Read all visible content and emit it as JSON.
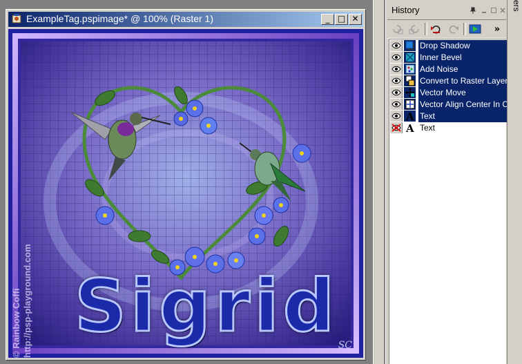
{
  "image_window": {
    "title": "ExampleTag.pspimage* @ 100% (Raster 1)",
    "minimize_symbol": "_",
    "maximize_symbol": "□",
    "close_symbol": "✕",
    "app_icon": "psp-image-icon"
  },
  "canvas": {
    "name_text": "Sigrid",
    "watermark_line1": "© Rainbow Coffi",
    "watermark_line2": "http://psp-playground.com",
    "signature": "SC"
  },
  "history": {
    "title": "History",
    "toolbar_icons": [
      "undo-selective-icon",
      "redo-selective-icon",
      "undo-icon",
      "redo-icon",
      "quickscript-icon",
      "more-icon"
    ],
    "more_label": "»",
    "items": [
      {
        "label": "Drop Shadow",
        "icon": "drop-shadow-icon",
        "visible": true,
        "selected": true
      },
      {
        "label": "Inner Bevel",
        "icon": "inner-bevel-icon",
        "visible": true,
        "selected": true
      },
      {
        "label": "Add Noise",
        "icon": "add-noise-icon",
        "visible": true,
        "selected": true
      },
      {
        "label": "Convert to Raster Layer",
        "icon": "convert-raster-icon",
        "visible": true,
        "selected": true
      },
      {
        "label": "Vector Move",
        "icon": "vector-move-icon",
        "visible": true,
        "selected": true
      },
      {
        "label": "Vector Align Center In Canvas",
        "icon": "vector-align-icon",
        "visible": true,
        "selected": true
      },
      {
        "label": "Text",
        "icon": "text-icon",
        "visible": true,
        "selected": true
      },
      {
        "label": "Text",
        "icon": "text-icon",
        "visible": false,
        "selected": false
      }
    ]
  },
  "right_panel": {
    "label": "ers"
  },
  "colors": {
    "titlebar_start": "#0a246a",
    "titlebar_end": "#a6caf0",
    "selection": "#0a246a",
    "panel": "#d4d0c8"
  }
}
